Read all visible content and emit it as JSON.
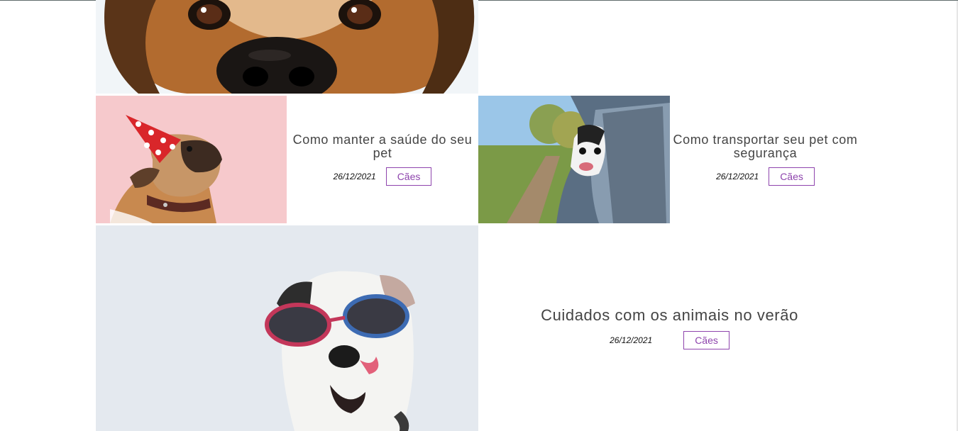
{
  "colors": {
    "tag_accent": "#8e44ad",
    "title_text": "#444444"
  },
  "posts": [
    {
      "image": "dog-nose-closeup-photo",
      "title": "",
      "date": "",
      "tag": ""
    },
    {
      "image": "pug-party-hat-photo",
      "title": "Como manter a saúde do seu pet",
      "date": "26/12/2021",
      "tag": "Cães"
    },
    {
      "image": "dog-car-window-photo",
      "title": "Como transportar seu pet com segurança",
      "date": "26/12/2021",
      "tag": "Cães"
    },
    {
      "image": "dog-sunglasses-photo",
      "title": "Cuidados com os animais no verão",
      "date": "26/12/2021",
      "tag": "Cães"
    }
  ]
}
